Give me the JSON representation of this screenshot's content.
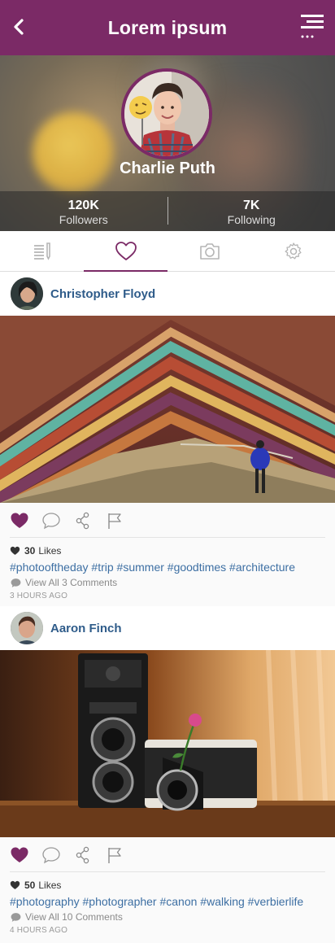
{
  "header": {
    "title": "Lorem ipsum"
  },
  "profile": {
    "name": "Charlie Puth",
    "followers_count": "120K",
    "followers_label": "Followers",
    "following_count": "7K",
    "following_label": "Following"
  },
  "tabs": [
    {
      "icon": "list-edit-icon"
    },
    {
      "icon": "heart-icon",
      "active": true
    },
    {
      "icon": "camera-icon"
    },
    {
      "icon": "gear-icon"
    }
  ],
  "colors": {
    "accent": "#7b2a66",
    "link": "#3d6fa3",
    "name": "#2f5c8a"
  },
  "posts": [
    {
      "author": "Christopher Floyd",
      "likes_count": "30",
      "likes_label": "Likes",
      "tags": "#photooftheday #trip #summer #goodtimes #architecture",
      "comments": "View All 3 Comments",
      "time": "3 HOURS AGO"
    },
    {
      "author": "Aaron Finch",
      "likes_count": "50",
      "likes_label": "Likes",
      "tags": "#photography #photographer #canon #walking #verbierlife",
      "comments": "View All 10 Comments",
      "time": "4 HOURS AGO"
    }
  ]
}
